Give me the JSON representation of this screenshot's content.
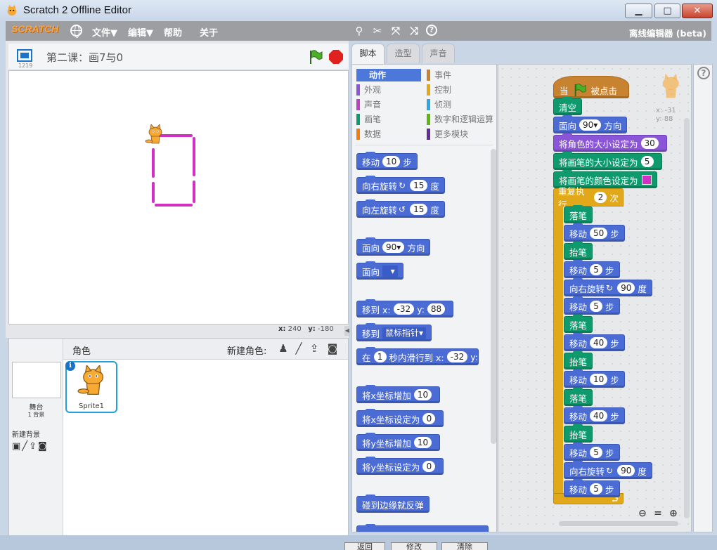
{
  "window": {
    "title": "Scratch 2 Offline Editor",
    "min_glyph": "▁",
    "max_glyph": "□",
    "close_glyph": "✕"
  },
  "menubar": {
    "logo": "SCRATCH",
    "items": [
      "文件▼",
      "编辑▼",
      "帮助",
      "关于"
    ],
    "tools": [
      "duplicate-icon",
      "cut-icon",
      "grow-icon",
      "shrink-icon",
      "help-icon"
    ],
    "offline_label": "离线编辑器 (beta)"
  },
  "stage": {
    "version": "1219",
    "project_title": "第二课：画7与0",
    "coords": {
      "x_label": "x:",
      "x": "240",
      "y_label": "y:",
      "y": "-180"
    },
    "pen_color": "#d22fc4"
  },
  "sprites": {
    "header": "角色",
    "new_sprite": "新建角色:",
    "stage_label": "舞台",
    "stage_backdrops": "1 背景",
    "new_backdrop": "新建背景",
    "list": [
      {
        "name": "Sprite1"
      }
    ]
  },
  "tabs": [
    "脚本",
    "造型",
    "声音"
  ],
  "categories": [
    {
      "label": "动作",
      "color": "#4a6cd4",
      "active": true
    },
    {
      "label": "事件",
      "color": "#c88330"
    },
    {
      "label": "外观",
      "color": "#8a55d7"
    },
    {
      "label": "控制",
      "color": "#e1a91a"
    },
    {
      "label": "声音",
      "color": "#bb42c3"
    },
    {
      "label": "侦测",
      "color": "#2ca5e2"
    },
    {
      "label": "画笔",
      "color": "#0e9a6c"
    },
    {
      "label": "数字和逻辑运算",
      "color": "#5cb712"
    },
    {
      "label": "数据",
      "color": "#ee7d16"
    },
    {
      "label": "更多模块",
      "color": "#632d99"
    }
  ],
  "palette_blocks": {
    "move": {
      "pre": "移动",
      "v": "10",
      "post": "步"
    },
    "turn_right": {
      "pre": "向右旋转",
      "v": "15",
      "post": "度"
    },
    "turn_left": {
      "pre": "向左旋转",
      "v": "15",
      "post": "度"
    },
    "point_dir": {
      "pre": "面向",
      "v": "90▾",
      "post": "方向"
    },
    "point_towards": {
      "pre": "面向"
    },
    "goto_xy": {
      "pre": "移到 x:",
      "x": "-32",
      "mid": "y:",
      "y": "88"
    },
    "goto": {
      "pre": "移到",
      "v": "鼠标指针▾"
    },
    "glide": {
      "pre": "在",
      "v": "1",
      "mid": "秒内滑行到 x:",
      "x": "-32",
      "mid2": "y:"
    },
    "change_x": {
      "pre": "将x坐标增加",
      "v": "10"
    },
    "set_x": {
      "pre": "将x坐标设定为",
      "v": "0"
    },
    "change_y": {
      "pre": "将y坐标增加",
      "v": "10"
    },
    "set_y": {
      "pre": "将y坐标设定为",
      "v": "0"
    },
    "bounce": {
      "pre": "碰到边缘就反弹"
    }
  },
  "script": {
    "hat": {
      "pre": "当",
      "post": "被点击"
    },
    "clear": "清空",
    "point": {
      "pre": "面向",
      "v": "90▾",
      "post": "方向"
    },
    "size": {
      "pre": "将角色的大小设定为",
      "v": "30"
    },
    "pen_size": {
      "pre": "将画笔的大小设定为",
      "v": "5"
    },
    "pen_color": {
      "pre": "将画笔的颜色设定为"
    },
    "repeat": {
      "pre": "重复执行",
      "v": "2",
      "post": "次"
    },
    "inner": [
      {
        "type": "pen",
        "text": "落笔"
      },
      {
        "type": "motion",
        "pre": "移动",
        "v": "50",
        "post": "步"
      },
      {
        "type": "pen",
        "text": "抬笔"
      },
      {
        "type": "motion",
        "pre": "移动",
        "v": "5",
        "post": "步"
      },
      {
        "type": "motion",
        "pre": "向右旋转",
        "v": "90",
        "post": "度",
        "rot": "↻"
      },
      {
        "type": "motion",
        "pre": "移动",
        "v": "5",
        "post": "步"
      },
      {
        "type": "pen",
        "text": "落笔"
      },
      {
        "type": "motion",
        "pre": "移动",
        "v": "40",
        "post": "步"
      },
      {
        "type": "pen",
        "text": "抬笔"
      },
      {
        "type": "motion",
        "pre": "移动",
        "v": "10",
        "post": "步"
      },
      {
        "type": "pen",
        "text": "落笔"
      },
      {
        "type": "motion",
        "pre": "移动",
        "v": "40",
        "post": "步"
      },
      {
        "type": "pen",
        "text": "抬笔"
      },
      {
        "type": "motion",
        "pre": "移动",
        "v": "5",
        "post": "步"
      },
      {
        "type": "motion",
        "pre": "向右旋转",
        "v": "90",
        "post": "度",
        "rot": "↻"
      },
      {
        "type": "motion",
        "pre": "移动",
        "v": "5",
        "post": "步"
      }
    ],
    "sprite_x": "x: -31",
    "sprite_y": "y: 88"
  },
  "bottom_buttons": [
    "返回",
    "修改",
    "清除"
  ]
}
